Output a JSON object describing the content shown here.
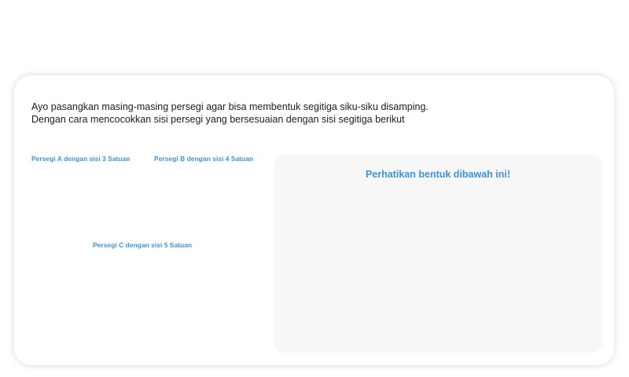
{
  "instructions": {
    "line1": "Ayo pasangkan masing-masing persegi agar bisa membentuk segitiga siku-siku disamping.",
    "line2": "Dengan cara mencocokkan sisi persegi yang bersesuaian dengan sisi segitiga berikut"
  },
  "squares": [
    {
      "label": "Persegi A dengan sisi 3 Satuan"
    },
    {
      "label": "Persegi B dengan sisi 4 Satuan"
    },
    {
      "label": "Persegi C dengan sisi 5 Satuan"
    }
  ],
  "target": {
    "title": "Perhatikan bentuk dibawah ini!"
  },
  "colors": {
    "accent": "#3d92e0",
    "panel_bg": "#f7f7f7",
    "text": "#1c1c1c"
  }
}
